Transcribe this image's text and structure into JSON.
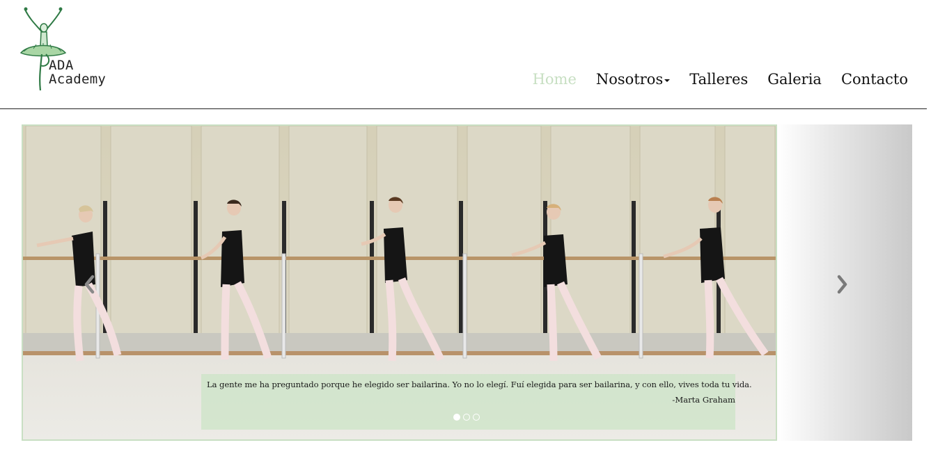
{
  "brand": {
    "line1": "ADA",
    "line2": "Academy",
    "logo_icon": "ballerina-icon"
  },
  "nav": {
    "items": [
      {
        "label": "Home",
        "active": true
      },
      {
        "label": "Nosotros",
        "dropdown": true
      },
      {
        "label": "Talleres"
      },
      {
        "label": "Galeria"
      },
      {
        "label": "Contacto"
      }
    ]
  },
  "carousel": {
    "prev_icon": "chevron-left-icon",
    "next_icon": "chevron-right-icon",
    "active_slide": 1,
    "slide_count": 3,
    "caption": {
      "quote": "La gente me ha preguntado porque he elegido ser bailarina. Yo no lo elegí. Fuí elegida para ser bailarina, y con ello, vives toda tu vida.",
      "author": "-Marta Graham"
    }
  },
  "colors": {
    "accent": "#c7dfc2",
    "caption_bg": "#cde4c8",
    "text": "#111111"
  }
}
